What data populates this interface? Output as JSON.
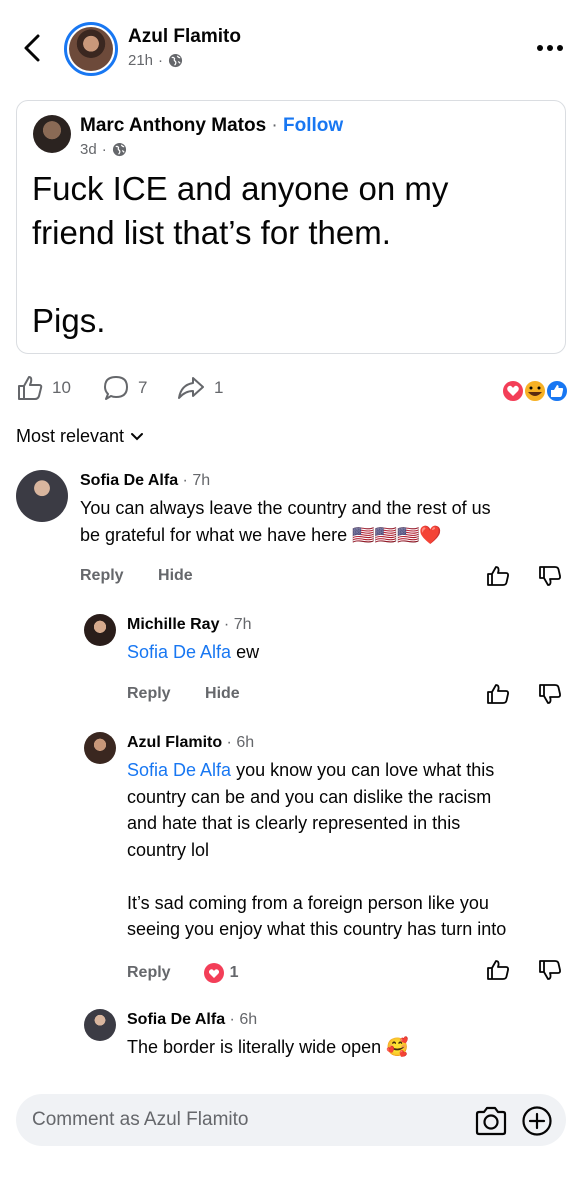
{
  "header": {
    "name": "Azul Flamito",
    "time": "21h",
    "dot": "·"
  },
  "shared_post": {
    "author": "Marc Anthony Matos",
    "dot": " · ",
    "follow_label": "Follow",
    "time": "3d",
    "meta_dot": "·",
    "text": "Fuck ICE and anyone on my\nfriend list that’s for them.\n\nPigs."
  },
  "actions": {
    "likes": "10",
    "comments": "7",
    "shares": "1",
    "reactions": [
      "love-icon",
      "haha-icon",
      "like-icon"
    ]
  },
  "sort": {
    "label": "Most relevant"
  },
  "comments": [
    {
      "author": "Sofia De Alfa",
      "time": " · 7h",
      "text": "You can always leave the country and the rest of us\nbe grateful for what we have here 🇺🇸🇺🇸🇺🇸❤️",
      "reply_label": "Reply",
      "hide_label": "Hide"
    },
    {
      "author": "Michille Ray",
      "time": " · 7h",
      "mention": "Sofia De Alfa",
      "text": " ew",
      "reply_label": "Reply",
      "hide_label": "Hide"
    },
    {
      "author": "Azul Flamito",
      "time": " · 6h",
      "mention": "Sofia De Alfa",
      "text": " you know you can love what this\ncountry can be and you can dislike the racism\nand hate that is clearly represented in this\ncountry lol\n\nIt’s sad coming from a foreign person like you\nseeing you enjoy what this country has turn into",
      "reply_label": "Reply",
      "reaction_count": "1"
    },
    {
      "author": "Sofia De Alfa",
      "time": " · 6h",
      "text": "The border is literally wide open 🥰"
    }
  ],
  "comment_bar": {
    "placeholder": "Comment as Azul Flamito"
  },
  "colors": {
    "accent": "#1877f2",
    "secondary_text": "#65676b",
    "love": "#f33e58"
  }
}
